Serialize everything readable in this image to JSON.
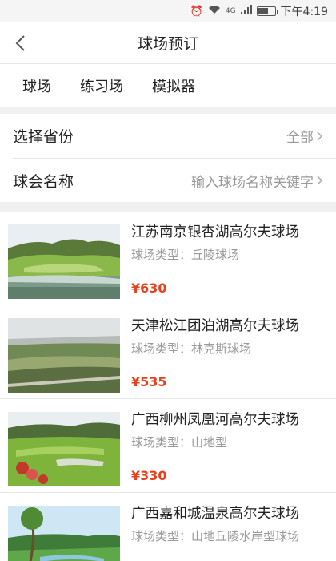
{
  "status_bar": {
    "time": "下午4:19",
    "net": "4G"
  },
  "header": {
    "title": "球场预订"
  },
  "tabs": [
    {
      "label": "球场"
    },
    {
      "label": "练习场"
    },
    {
      "label": "模拟器"
    }
  ],
  "filters": {
    "province": {
      "label": "选择省份",
      "value": "全部"
    },
    "club_name": {
      "label": "球会名称",
      "placeholder": "输入球场名称关键字"
    }
  },
  "courses": [
    {
      "name": "江苏南京银杏湖高尔夫球场",
      "type": "球场类型：丘陵球场",
      "price": "¥630"
    },
    {
      "name": "天津松江团泊湖高尔夫球场",
      "type": "球场类型：林克斯球场",
      "price": "¥535"
    },
    {
      "name": "广西柳州凤凰河高尔夫球场",
      "type": "球场类型：山地型",
      "price": "¥330"
    },
    {
      "name": "广西嘉和城温泉高尔夫球场",
      "type": "球场类型：山地丘陵水岸型球场",
      "price": ""
    }
  ],
  "colors": {
    "price": "#e8401c",
    "muted": "#999999"
  }
}
